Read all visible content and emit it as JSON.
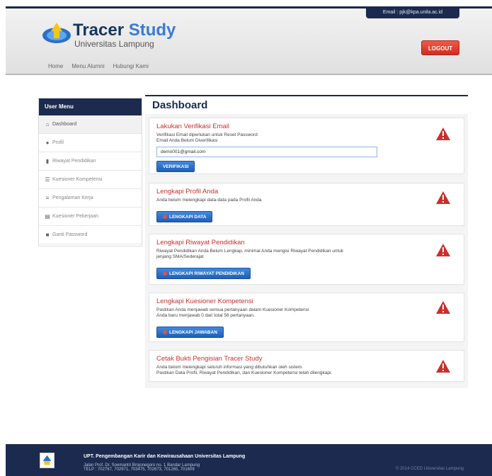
{
  "header": {
    "email_badge": "Email : pjk@kpa.unila.ac.id",
    "brand_title_a": "Tracer ",
    "brand_title_b": "Study",
    "brand_sub": "Universitas Lampung",
    "logout_label": "LOGOUT",
    "nav": [
      "Home",
      "Menu Alumni",
      "Hubungi Kami"
    ]
  },
  "sidebar": {
    "heading": "User Menu",
    "items": [
      {
        "label": "Dashboard",
        "icon": "home-icon"
      },
      {
        "label": "Profil",
        "icon": "user-icon"
      },
      {
        "label": "Riwayat Pendidikan",
        "icon": "book-icon"
      },
      {
        "label": "Kuesioner Kompetensi",
        "icon": "list-icon"
      },
      {
        "label": "Pengalaman Kerja",
        "icon": "briefcase-icon"
      },
      {
        "label": "Kuesioner Pekerjaan",
        "icon": "clipboard-icon"
      },
      {
        "label": "Ganti Password",
        "icon": "lock-icon"
      }
    ]
  },
  "main": {
    "title": "Dashboard",
    "cards": {
      "email": {
        "title": "Lakukan Verifikasi Email",
        "line1": "Verifikasi Email diperlukan untuk Reset Password",
        "line2": "Email Anda Belum Diverifikasi",
        "input_value": "demo001@gmail.com",
        "button": "VERIFIKASI"
      },
      "profil": {
        "title": "Lengkapi Profil Anda",
        "line1": "Anda belum melengkapi data-data pada Profil Anda",
        "button": "LENGKAPI DATA"
      },
      "riwayat": {
        "title": "Lengkapi Riwayat Pendidikan",
        "line1": "Riwayat Pendidikan Anda Belum Lengkap, minimal Anda mengisi Riwayat Pendidikan untuk",
        "line2": "jenjang SMA/Sederajat",
        "button": "LENGKAPI RIWAYAT PENDIDIKAN"
      },
      "kuesioner": {
        "title": "Lengkapi Kuesioner Kompetensi",
        "line1": "Pastikan Anda menjawab semua pertanyaan dalam Kuesioner Kompetensi",
        "line2": "Anda baru menjawab 0 dari total 56 pertanyaan.",
        "button": "LENGKAPI JAWABAN"
      },
      "cetak": {
        "title": "Cetak Bukti Pengisian Tracer Study",
        "line1": "Anda belum melengkapi seluruh informasi yang dibutuhkan oleh sistem.",
        "line2": "Pastikan Data Profil, Riwayat Pendidikan, dan Kuesioner Kompetensi telah dilengkapi."
      }
    }
  },
  "footer": {
    "title": "UPT. Pengembangan Karir dan Kewirausahaan Universitas Lampung",
    "addr1": "Jalan Prof. Dr. Soemantri Brojonegoro no. 1 Bandar Lampung",
    "addr2": "TELP : 702767, 702971, 703475, 702673, 701265, 701609",
    "copyright": "© 2014 CCED Universitas Lampung"
  },
  "colors": {
    "navy": "#1b2a4e",
    "accent": "#3a7bd5",
    "alert": "#c9302c"
  }
}
